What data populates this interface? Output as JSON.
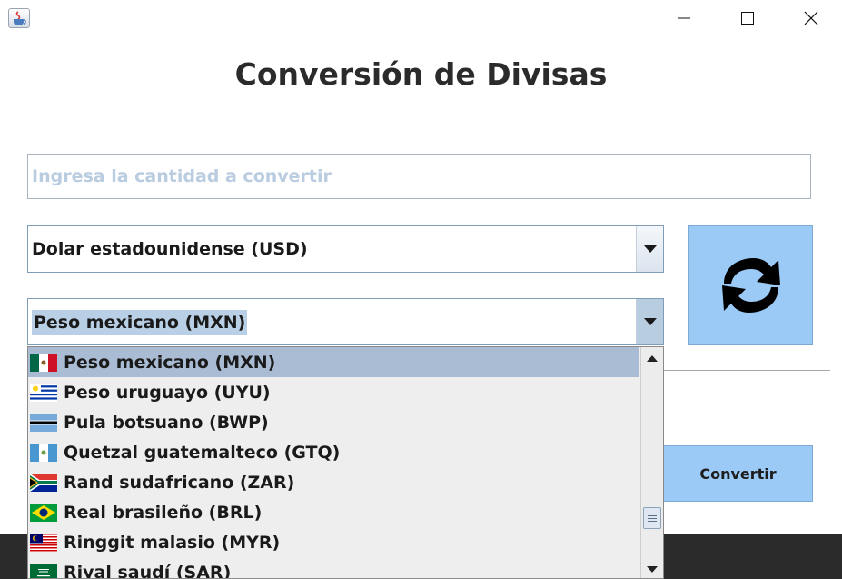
{
  "window": {
    "icon": "java-cup-icon",
    "controls": [
      "minimize-icon",
      "maximize-icon",
      "close-icon"
    ]
  },
  "heading": "Conversión de Divisas",
  "amount_input": {
    "placeholder": "Ingresa la cantidad a convertir",
    "value": ""
  },
  "from_currency": {
    "selected": "Dolar estadounidense (USD)"
  },
  "to_currency": {
    "selected": "Peso mexicano (MXN)",
    "options": [
      {
        "label": "Peso mexicano (MXN)",
        "flag": "mexico-flag-icon"
      },
      {
        "label": "Peso uruguayo (UYU)",
        "flag": "uruguay-flag-icon"
      },
      {
        "label": "Pula botsuano (BWP)",
        "flag": "botswana-flag-icon"
      },
      {
        "label": "Quetzal guatemalteco (GTQ)",
        "flag": "guatemala-flag-icon"
      },
      {
        "label": "Rand sudafricano (ZAR)",
        "flag": "south-africa-flag-icon"
      },
      {
        "label": "Real brasileño (BRL)",
        "flag": "brazil-flag-icon"
      },
      {
        "label": "Ringgit malasio (MYR)",
        "flag": "malaysia-flag-icon"
      },
      {
        "label": "Riyal saudí (SAR)",
        "flag": "saudi-arabia-flag-icon"
      }
    ]
  },
  "swap_button": {
    "icon": "swap-arrows-icon"
  },
  "convert_button": {
    "label": "Convertir"
  },
  "colors": {
    "button_bg": "#9ccaf7",
    "selection_bg": "#a9bcd4",
    "placeholder": "#b9cce0",
    "footer_bg": "#2b2b2b"
  }
}
